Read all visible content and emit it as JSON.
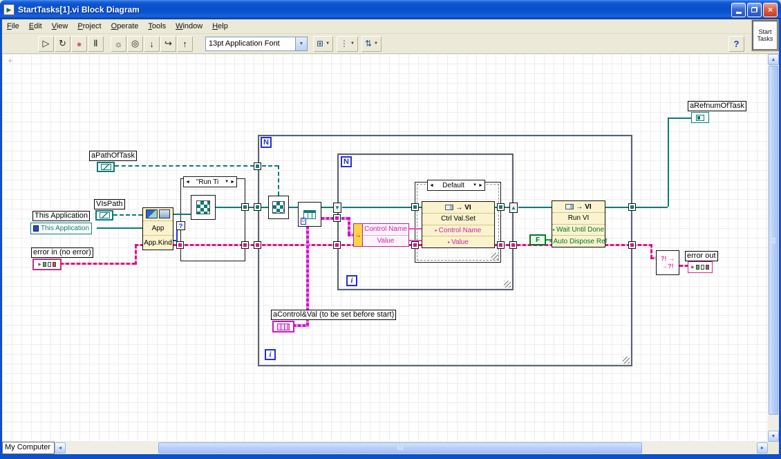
{
  "window": {
    "title": "StartTasks[1].vi Block Diagram",
    "context": "My Computer"
  },
  "menu": {
    "items": [
      "File",
      "Edit",
      "View",
      "Project",
      "Operate",
      "Tools",
      "Window",
      "Help"
    ]
  },
  "toolbar": {
    "font": "13pt Application Font"
  },
  "vi_icon": {
    "line1": "Start",
    "line2": "Tasks"
  },
  "icons": {
    "run": "▷",
    "run_continuous": "↻",
    "abort": "●",
    "pause": "Ⅱ",
    "highlight": "☼",
    "retain": "◎",
    "step_into": "↓",
    "step_over": "↪",
    "step_out": "↑",
    "dropdown": "▼",
    "help": "?",
    "align": "⊞",
    "distribute": "⋮",
    "reorder": "⇅",
    "case_prev": "◄",
    "case_next": "►",
    "case_drop": "▼",
    "scroll_up": "▲",
    "scroll_down": "▼",
    "scroll_left": "◄",
    "scroll_right": "►",
    "close": "×",
    "shift_down": "▼",
    "shift_up": "▲",
    "selector": "?",
    "unbundle_arrow": "→",
    "invoke_arrow": "→"
  },
  "diagram": {
    "labels": {
      "a_path_of_task": "aPathOfTask",
      "vis_path": "VIsPath",
      "this_application": "This Application",
      "this_application_const": "This Application",
      "error_in": "error in (no error)",
      "a_control_val": "aControl&Val (to be set before start)",
      "a_refnum_of_task": "aRefnumOfTask",
      "error_out": "error out"
    },
    "loop_count": "N",
    "loop_iter": "i",
    "case1_selector": "\"Run Ti",
    "case2_selector": "Default",
    "app_node": {
      "class_row": "App",
      "property": "App.Kind"
    },
    "unbundle": {
      "rows": [
        "Control Name",
        "Value"
      ]
    },
    "invoke_ctrl": {
      "cls": "VI",
      "method": "Ctrl Val.Set",
      "params": [
        "Control Name",
        "Value"
      ]
    },
    "invoke_run": {
      "cls": "VI",
      "method": "Run VI",
      "params": [
        "Wait Until Done",
        "Auto Dispose Ref"
      ]
    },
    "bool_const": "F",
    "index_const": "0"
  }
}
